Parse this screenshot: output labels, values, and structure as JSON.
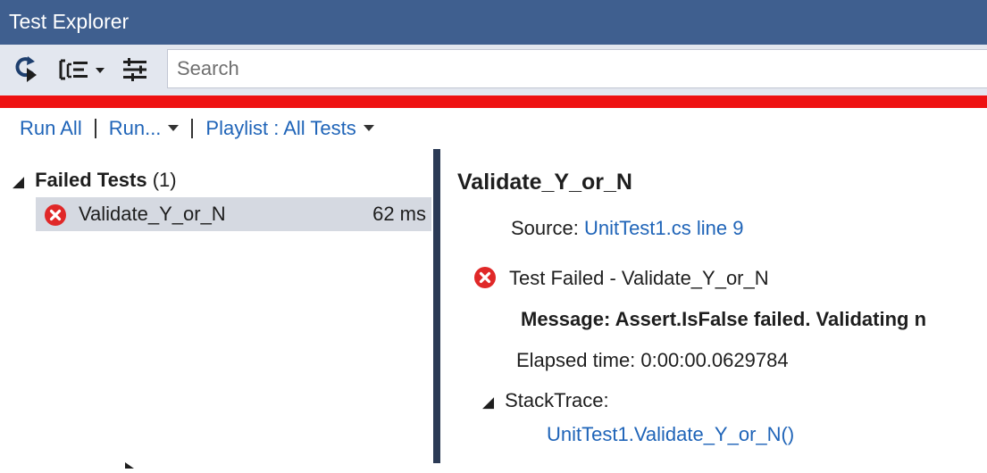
{
  "window": {
    "title": "Test Explorer"
  },
  "toolbar": {
    "run_icon": "run-tests-icon",
    "group_icon": "group-by-icon",
    "settings_icon": "list-settings-icon",
    "search_placeholder": "Search"
  },
  "status": {
    "bar_color": "#ee1111"
  },
  "actions": {
    "run_all": "Run All",
    "run": "Run...",
    "playlist": "Playlist : All Tests"
  },
  "tests": {
    "group_label": "Failed Tests",
    "group_count": "(1)",
    "items": [
      {
        "name": "Validate_Y_or_N",
        "duration": "62 ms",
        "status_icon": "error-icon"
      }
    ]
  },
  "detail": {
    "title": "Validate_Y_or_N",
    "source_label": "Source:",
    "source_link": "UnitTest1.cs line 9",
    "result": "Test Failed - Validate_Y_or_N",
    "message": "Message: Assert.IsFalse failed. Validating n",
    "elapsed": "Elapsed time: 0:00:00.0629784",
    "stacktrace_label": "StackTrace:",
    "stacktrace_link": "UnitTest1.Validate_Y_or_N()"
  },
  "colors": {
    "titlebar": "#3f5f8f",
    "toolbar": "#e3e7ef",
    "link": "#1f64b8",
    "error": "#e02828",
    "selected_row": "#d5d9e1",
    "splitter": "#2b3a55"
  }
}
